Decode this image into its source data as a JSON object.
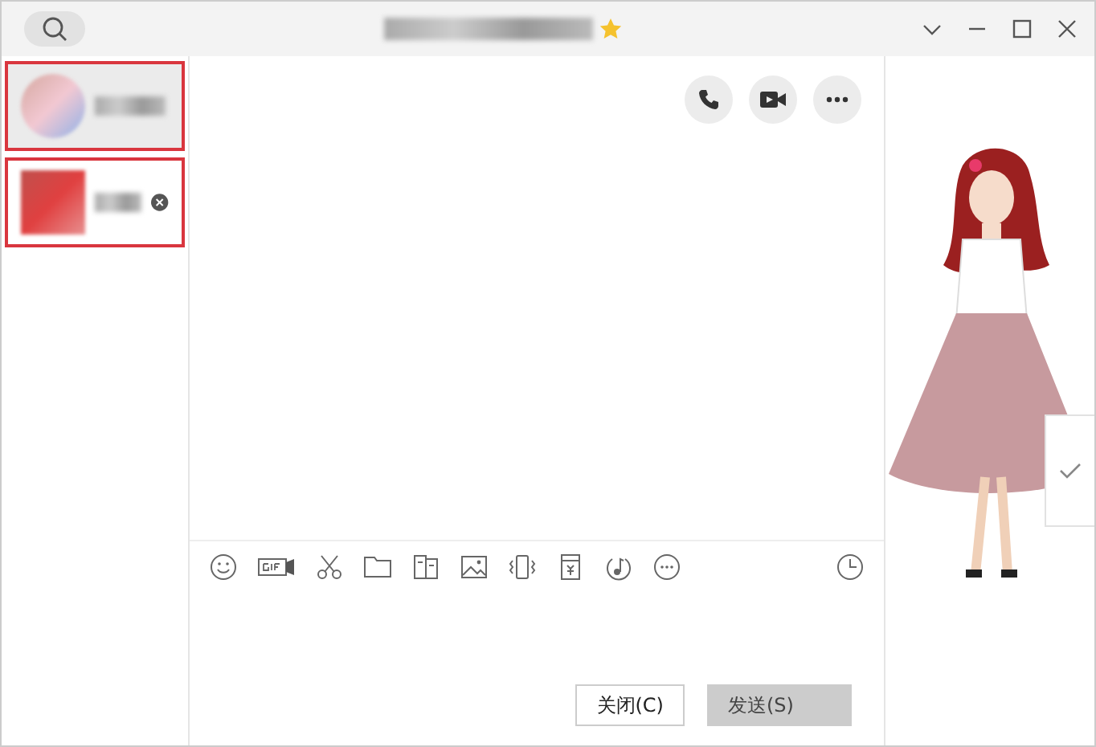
{
  "contacts": [
    {
      "selected": true,
      "annotated": true,
      "show_remove": false
    },
    {
      "selected": false,
      "annotated": true,
      "show_remove": true
    }
  ],
  "buttons": [
    {
      "label": "关闭(C)",
      "kind": "close",
      "disabled": false
    },
    {
      "label": "发送(S)",
      "kind": "send",
      "disabled": true
    }
  ]
}
